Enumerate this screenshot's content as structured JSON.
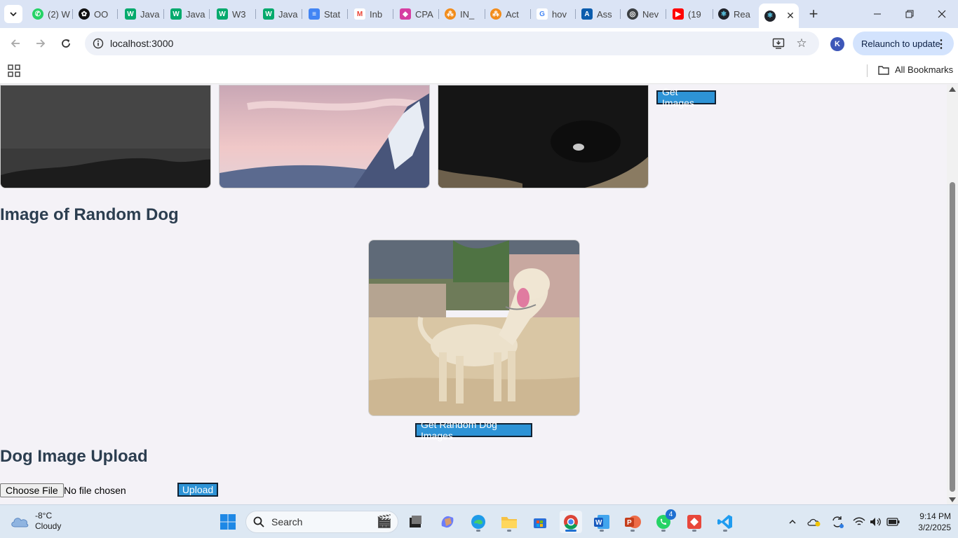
{
  "tabs": [
    {
      "label": "(2) W",
      "icon": "whatsapp-icon"
    },
    {
      "label": "OO",
      "icon": "chatgpt-icon"
    },
    {
      "label": "Java",
      "icon": "w3schools-icon"
    },
    {
      "label": "Java",
      "icon": "w3schools-icon"
    },
    {
      "label": "W3",
      "icon": "w3schools-icon"
    },
    {
      "label": "Java",
      "icon": "w3schools-icon"
    },
    {
      "label": "Stat",
      "icon": "google-docs-icon"
    },
    {
      "label": "Inb",
      "icon": "gmail-icon"
    },
    {
      "label": "CPA",
      "icon": "gem-icon"
    },
    {
      "label": "IN_",
      "icon": "orange-hub-icon"
    },
    {
      "label": "Act",
      "icon": "orange-hub-icon"
    },
    {
      "label": "hov",
      "icon": "google-icon"
    },
    {
      "label": "Ass",
      "icon": "azure-icon"
    },
    {
      "label": "Nev",
      "icon": "globe-icon"
    },
    {
      "label": "(19",
      "icon": "youtube-icon"
    },
    {
      "label": "Rea",
      "icon": "react-icon"
    }
  ],
  "active_tab": {
    "icon": "react-icon",
    "close": "✕"
  },
  "toolbar": {
    "url": "localhost:3000",
    "profile_initial": "K",
    "relaunch_label": "Relaunch to update"
  },
  "bookmarks": {
    "all_label": "All Bookmarks"
  },
  "page": {
    "get_images_label": "Get Images",
    "random_heading": "Image of Random Dog",
    "random_button_label": "Get Random Dog Images",
    "upload_heading": "Dog Image Upload",
    "choose_file_label": "Choose File",
    "no_file_text": "No file chosen",
    "upload_label": "Upload"
  },
  "taskbar": {
    "temperature": "-8°C",
    "weather_text": "Cloudy",
    "search_placeholder": "Search",
    "whatsapp_badge": "4",
    "time": "9:14 PM",
    "date": "3/2/2025"
  },
  "colors": {
    "accent_button": "#2d93d6",
    "heading": "#2c3e50",
    "page_bg": "#f4f2f7"
  }
}
